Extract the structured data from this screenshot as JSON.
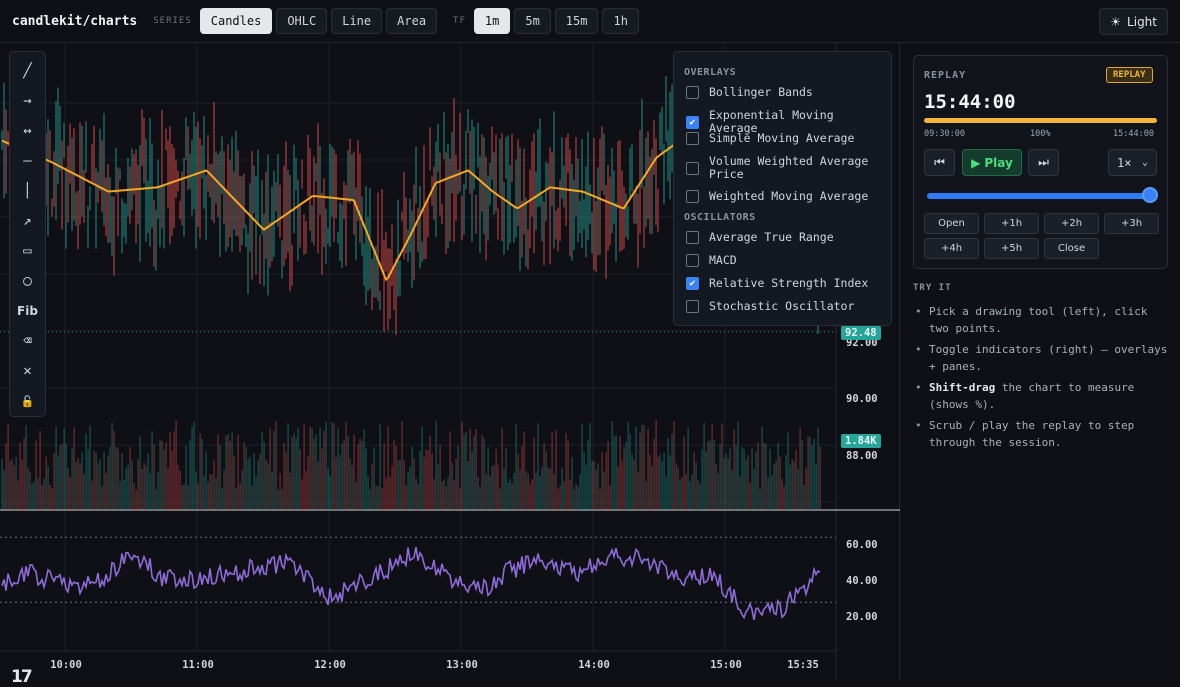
{
  "brand": "candlekit/charts",
  "toolbar": {
    "series_label": "SERIES",
    "series": [
      "Candles",
      "OHLC",
      "Line",
      "Area"
    ],
    "series_active": 0,
    "tf_label": "TF",
    "timeframes": [
      "1m",
      "5m",
      "15m",
      "1h"
    ],
    "tf_active": 0,
    "theme_label": "Light"
  },
  "tools": [
    "trend-line",
    "arrow",
    "extended-line",
    "horizontal-line",
    "vertical-line",
    "ray",
    "rectangle",
    "circle",
    "Fib",
    "eraser",
    "clear",
    "lock"
  ],
  "indicators": {
    "overlays_title": "OVERLAYS",
    "overlays": [
      {
        "label": "Bollinger Bands",
        "checked": false
      },
      {
        "label": "Exponential Moving Average",
        "checked": true
      },
      {
        "label": "Simple Moving Average",
        "checked": false
      },
      {
        "label": "Volume Weighted Average Price",
        "checked": false
      },
      {
        "label": "Weighted Moving Average",
        "checked": false
      }
    ],
    "oscillators_title": "OSCILLATORS",
    "oscillators": [
      {
        "label": "Average True Range",
        "checked": false
      },
      {
        "label": "MACD",
        "checked": false
      },
      {
        "label": "Relative Strength Index",
        "checked": true
      },
      {
        "label": "Stochastic Oscillator",
        "checked": false
      }
    ]
  },
  "price_axis": {
    "ticks": [
      "92.00",
      "90.00",
      "88.00"
    ],
    "last_price": "92.48",
    "last_volume": "1.84K"
  },
  "rsi_axis": {
    "ticks": [
      "60.00",
      "40.00",
      "20.00"
    ]
  },
  "time_axis": {
    "ticks": [
      "10:00",
      "11:00",
      "12:00",
      "13:00",
      "14:00",
      "15:00",
      "15:35"
    ]
  },
  "colors": {
    "up": "#26a69a",
    "down": "#ef5350",
    "ema": "#f5a623",
    "rsi": "#8e6bd8",
    "accent": "#3b82f6",
    "replay": "#f0b53a"
  },
  "replay": {
    "title": "REPLAY",
    "badge": "REPLAY",
    "time": "15:44:00",
    "progress": 1.0,
    "start": "09:30:00",
    "percent": "100%",
    "end": "15:44:00",
    "play_label": "Play",
    "speed": "1×",
    "jumps": [
      "Open",
      "+1h",
      "+2h",
      "+3h",
      "+4h",
      "+5h",
      "Close"
    ]
  },
  "tips": {
    "title": "TRY IT",
    "items": [
      {
        "bold": "",
        "text": "Pick a drawing tool (left), click two points."
      },
      {
        "bold": "",
        "text": "Toggle indicators (right) — overlays + panes."
      },
      {
        "bold": "Shift-drag",
        "text": " the chart to measure (shows %)."
      },
      {
        "bold": "",
        "text": "Scrub / play the replay to step through the session."
      }
    ]
  },
  "chart_data": {
    "type": "candlestick",
    "x_range": [
      "09:30",
      "15:44"
    ],
    "y_range": [
      86.5,
      97.5
    ],
    "ema_anchors": [
      [
        0,
        95.2
      ],
      [
        0.06,
        94.7
      ],
      [
        0.13,
        94.0
      ],
      [
        0.19,
        94.1
      ],
      [
        0.25,
        94.5
      ],
      [
        0.32,
        93.1
      ],
      [
        0.38,
        93.9
      ],
      [
        0.43,
        93.8
      ],
      [
        0.47,
        91.9
      ],
      [
        0.5,
        93.0
      ],
      [
        0.53,
        94.2
      ],
      [
        0.57,
        94.5
      ],
      [
        0.6,
        94.0
      ],
      [
        0.63,
        93.6
      ],
      [
        0.67,
        94.1
      ],
      [
        0.71,
        94.0
      ],
      [
        0.76,
        93.6
      ],
      [
        0.8,
        94.8
      ],
      [
        0.85,
        95.5
      ],
      [
        0.9,
        95.0
      ],
      [
        0.94,
        93.8
      ],
      [
        0.97,
        92.8
      ],
      [
        1.0,
        92.5
      ]
    ],
    "rsi_anchors": [
      [
        0,
        40
      ],
      [
        0.03,
        48
      ],
      [
        0.07,
        43
      ],
      [
        0.11,
        40
      ],
      [
        0.16,
        60
      ],
      [
        0.2,
        44
      ],
      [
        0.25,
        45
      ],
      [
        0.3,
        50
      ],
      [
        0.35,
        55
      ],
      [
        0.4,
        33
      ],
      [
        0.45,
        44
      ],
      [
        0.5,
        60
      ],
      [
        0.55,
        45
      ],
      [
        0.59,
        38
      ],
      [
        0.62,
        50
      ],
      [
        0.66,
        56
      ],
      [
        0.7,
        48
      ],
      [
        0.74,
        58
      ],
      [
        0.79,
        56
      ],
      [
        0.83,
        43
      ],
      [
        0.87,
        46
      ],
      [
        0.91,
        24
      ],
      [
        0.95,
        25
      ],
      [
        0.98,
        39
      ],
      [
        1.0,
        50
      ]
    ]
  }
}
